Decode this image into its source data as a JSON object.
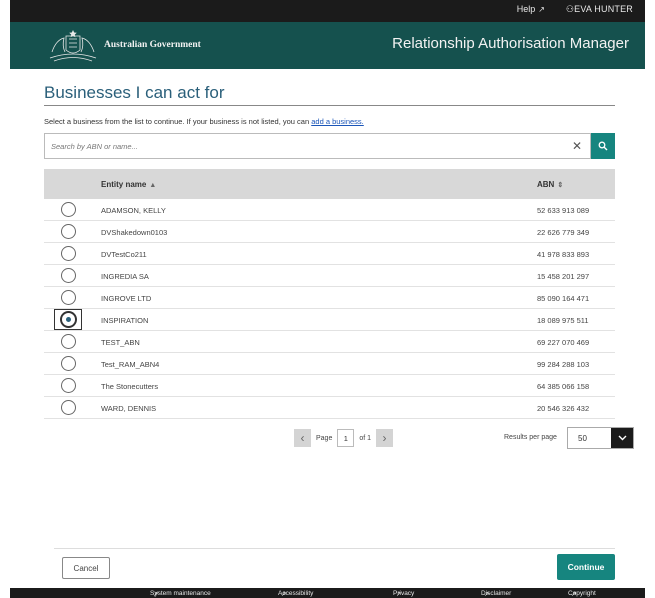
{
  "utility": {
    "help": "Help",
    "user": "EVA HUNTER"
  },
  "header": {
    "gov_name": "Australian Government",
    "app_title": "Relationship Authorisation Manager"
  },
  "main": {
    "title": "Businesses I can act for",
    "instructions": "Select a business from the list to continue. If your business is not listed, you can ",
    "instructions_link": "add a business.",
    "search_placeholder": "Search by ABN or name..."
  },
  "table": {
    "columns": {
      "name": "Entity name",
      "abn": "ABN"
    },
    "rows": [
      {
        "name": "ADAMSON, KELLY",
        "abn": "52 633 913 089",
        "selected": false
      },
      {
        "name": "DVShakedown0103",
        "abn": "22 626 779 349",
        "selected": false
      },
      {
        "name": "DVTestCo211",
        "abn": "41 978 833 893",
        "selected": false
      },
      {
        "name": "INGREDIA SA",
        "abn": "15 458 201 297",
        "selected": false
      },
      {
        "name": "INGROVE LTD",
        "abn": "85 090 164 471",
        "selected": false
      },
      {
        "name": "INSPIRATION",
        "abn": "18 089 975 511",
        "selected": true
      },
      {
        "name": "TEST_ABN",
        "abn": "69 227 070 469",
        "selected": false
      },
      {
        "name": "Test_RAM_ABN4",
        "abn": "99 284 288 103",
        "selected": false
      },
      {
        "name": "The Stonecutters",
        "abn": "64 385 066 158",
        "selected": false
      },
      {
        "name": "WARD, DENNIS",
        "abn": "20 546 326 432",
        "selected": false
      }
    ]
  },
  "pagination": {
    "page_label": "Page",
    "current_page": "1",
    "of_label": "of 1",
    "results_per_page_label": "Results per page",
    "results_per_page": "50"
  },
  "actions": {
    "cancel": "Cancel",
    "continue": "Continue"
  },
  "footer_links": [
    "System maintenance",
    "Accessibility",
    "Privacy",
    "Disclaimer",
    "Copyright"
  ],
  "colors": {
    "header_bg": "#15514e",
    "accent": "#16857f",
    "title": "#2a5f7a",
    "dark_bar": "#1b1b1b"
  }
}
